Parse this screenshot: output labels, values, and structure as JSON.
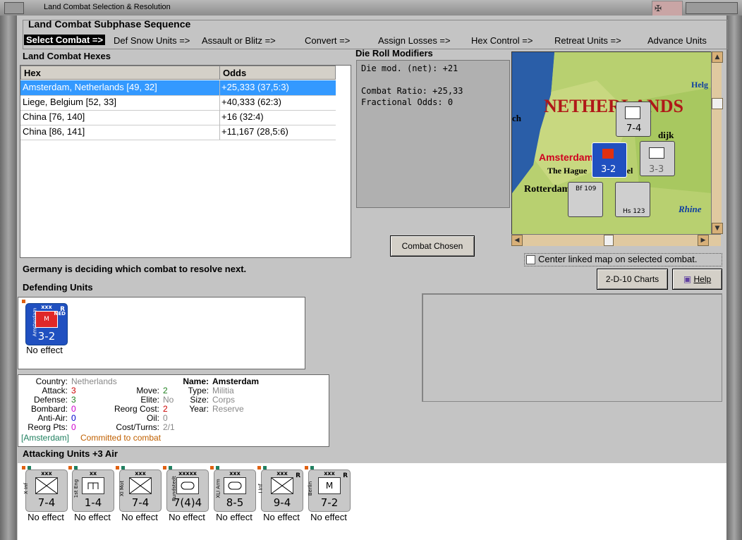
{
  "window": {
    "title": "Land Combat Selection & Resolution"
  },
  "phase": {
    "title": "Land Combat Subphase Sequence",
    "steps": [
      "Select Combat =>",
      "Def Snow Units =>",
      "Assault or Blitz =>",
      "Convert =>",
      "Assign Losses =>",
      "Hex Control =>",
      "Retreat Units =>",
      "Advance Units"
    ],
    "active_index": 0
  },
  "hexes": {
    "title": "Land Combat Hexes",
    "columns": [
      "Hex",
      "Odds"
    ],
    "rows": [
      {
        "hex": "Amsterdam, Netherlands [49, 32]",
        "odds": "+25,333 (37,5:3)"
      },
      {
        "hex": "Liege, Belgium [52, 33]",
        "odds": "+40,333 (62:3)"
      },
      {
        "hex": "China [76, 140]",
        "odds": "+16 (32:4)"
      },
      {
        "hex": "China [86, 141]",
        "odds": "+11,167 (28,5:6)"
      }
    ],
    "selected_index": 0
  },
  "die_roll": {
    "title": "Die Roll Modifiers",
    "lines": [
      "Die mod. (net): +21",
      "",
      "Combat Ratio: +25,33",
      "Fractional Odds: 0"
    ]
  },
  "map": {
    "labels": [
      "NETHERLANDS",
      "Amsterdam",
      "The Hague",
      "Rotterdam",
      "Rhine",
      "Helg",
      "dijk",
      "ch",
      "sel"
    ]
  },
  "center_check": {
    "label": "Center linked map on selected combat.",
    "checked": false
  },
  "buttons": {
    "combat_chosen": "Combat Chosen",
    "charts": "2-D-10 Charts",
    "help": "Help"
  },
  "status": "Germany is deciding which combat to resolve next.",
  "defending": {
    "title": "Defending Units",
    "units": [
      {
        "size": "xxx",
        "side": "Amsterdam",
        "nat": "NED",
        "tag": "R",
        "strength": "3-2",
        "effect": "No effect"
      }
    ]
  },
  "info": {
    "country_label": "Country:",
    "country": "Netherlands",
    "attack_label": "Attack:",
    "attack": "3",
    "defense_label": "Defense:",
    "defense": "3",
    "bombard_label": "Bombard:",
    "bombard": "0",
    "antiair_label": "Anti-Air:",
    "antiair": "0",
    "reorg_pts_label": "Reorg Pts:",
    "reorg_pts": "0",
    "move_label": "Move:",
    "move": "2",
    "elite_label": "Elite:",
    "elite": "No",
    "reorg_cost_label": "Reorg Cost:",
    "reorg_cost": "2",
    "oil_label": "Oil:",
    "oil": "0",
    "cost_turns_label": "Cost/Turns:",
    "cost_turns": "2/1",
    "name_label": "Name:",
    "name": "Amsterdam",
    "type_label": "Type:",
    "type": "Militia",
    "size_label": "Size:",
    "size": "Corps",
    "year_label": "Year:",
    "year": "Reserve",
    "commit_tag": "[Amsterdam]",
    "commit_text": "Committed to combat",
    "colors": {
      "attack": "#cc0000",
      "defense": "#208020",
      "bombard": "#cc00cc",
      "antiair": "#0000cc",
      "reorg": "#cc00cc",
      "muted": "#888888",
      "commit": "#c06000",
      "tag": "#208060"
    }
  },
  "attacking": {
    "title": "Attacking Units +3 Air",
    "units": [
      {
        "size": "xxx",
        "side": "X Inf",
        "sym": "inf",
        "strength": "7-4",
        "r": "",
        "effect": "No effect"
      },
      {
        "size": "xx",
        "side": "1st Eng",
        "sym": "eng",
        "strength": "1-4",
        "r": "",
        "effect": "No effect"
      },
      {
        "size": "xxx",
        "side": "XI Mot",
        "sym": "mot",
        "strength": "7-4",
        "r": "",
        "effect": "No effect"
      },
      {
        "size": "xxxxx",
        "side": "Rundstedt",
        "sym": "arm",
        "strength": "7(4)4",
        "r": "",
        "effect": "No effect"
      },
      {
        "size": "xxx",
        "side": "XLI Arm",
        "sym": "arm",
        "strength": "8-5",
        "r": "",
        "effect": "No effect"
      },
      {
        "size": "xxx",
        "side": "I Inf",
        "sym": "inf",
        "strength": "9-4",
        "r": "R",
        "effect": "No effect"
      },
      {
        "size": "xxx",
        "side": "Berlin",
        "sym": "mil",
        "strength": "7-2",
        "r": "R",
        "effect": "No effect"
      }
    ]
  }
}
